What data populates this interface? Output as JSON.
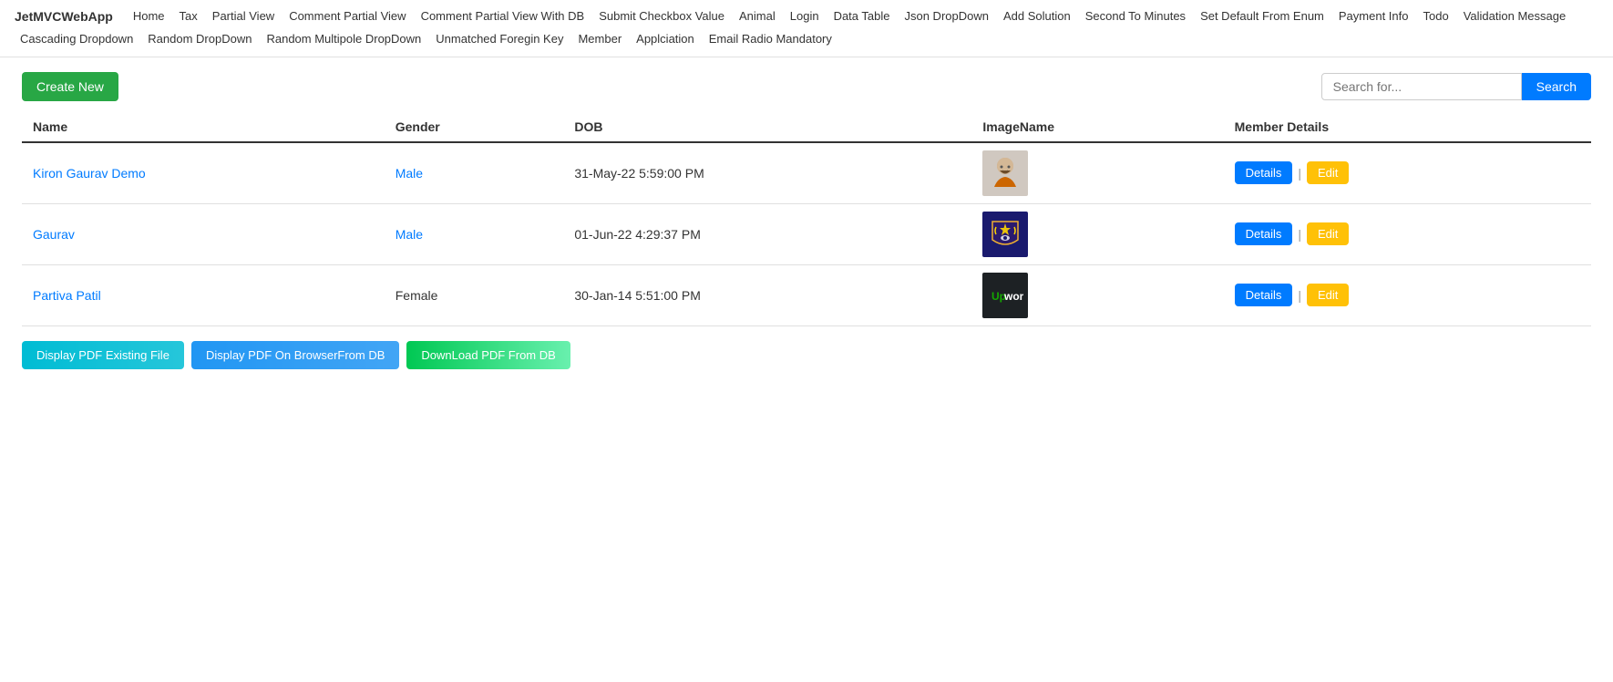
{
  "brand": "JetMVCWebApp",
  "nav": {
    "items": [
      {
        "label": "Home",
        "multiline": false
      },
      {
        "label": "Tax",
        "multiline": false
      },
      {
        "label": "Partial View",
        "multiline": false
      },
      {
        "label": "Comment Partial View",
        "multiline": false
      },
      {
        "label": "Comment Partial View With DB",
        "multiline": false
      },
      {
        "label": "Submit Checkbox Value",
        "multiline": false
      },
      {
        "label": "Animal",
        "multiline": false
      },
      {
        "label": "Login",
        "multiline": false
      },
      {
        "label": "Data Table",
        "multiline": false
      },
      {
        "label": "Json DropDown",
        "multiline": false
      },
      {
        "label": "Add Solution",
        "multiline": false
      },
      {
        "label": "Second To Minutes",
        "multiline": false
      },
      {
        "label": "Set Default From Enum",
        "multiline": false
      },
      {
        "label": "Payment Info",
        "multiline": false
      },
      {
        "label": "Todo",
        "multiline": false
      },
      {
        "label": "Validation Message",
        "multiline": false
      },
      {
        "label": "Cascading Dropdown",
        "multiline": false
      },
      {
        "label": "Random DropDown",
        "multiline": false
      },
      {
        "label": "Random Multipole DropDown",
        "multiline": false
      },
      {
        "label": "Unmatched Foregin Key",
        "multiline": false
      },
      {
        "label": "Member",
        "multiline": false
      },
      {
        "label": "Applciation",
        "multiline": false
      },
      {
        "label": "Email Radio Mandatory",
        "multiline": false
      }
    ]
  },
  "toolbar": {
    "create_label": "Create New",
    "search_placeholder": "Search for...",
    "search_button_label": "Search"
  },
  "table": {
    "columns": [
      "Name",
      "Gender",
      "DOB",
      "ImageName",
      "Member Details"
    ],
    "rows": [
      {
        "name": "Kiron Gaurav Demo",
        "gender": "Male",
        "dob": "31-May-22 5:59:00 PM",
        "image_type": "monk",
        "details_label": "Details",
        "separator": "|",
        "edit_label": "Edit"
      },
      {
        "name": "Gaurav",
        "gender": "Male",
        "dob": "01-Jun-22 4:29:37 PM",
        "image_type": "crest",
        "details_label": "Details",
        "separator": "|",
        "edit_label": "Edit"
      },
      {
        "name": "Partiva Patil",
        "gender": "Female",
        "dob": "30-Jan-14 5:51:00 PM",
        "image_type": "upwork",
        "details_label": "Details",
        "separator": "|",
        "edit_label": "Edit"
      }
    ]
  },
  "bottom_buttons": {
    "pdf1": "Display PDF Existing File",
    "pdf2": "Display PDF On BrowserFrom DB",
    "pdf3": "DownLoad PDF From DB"
  }
}
